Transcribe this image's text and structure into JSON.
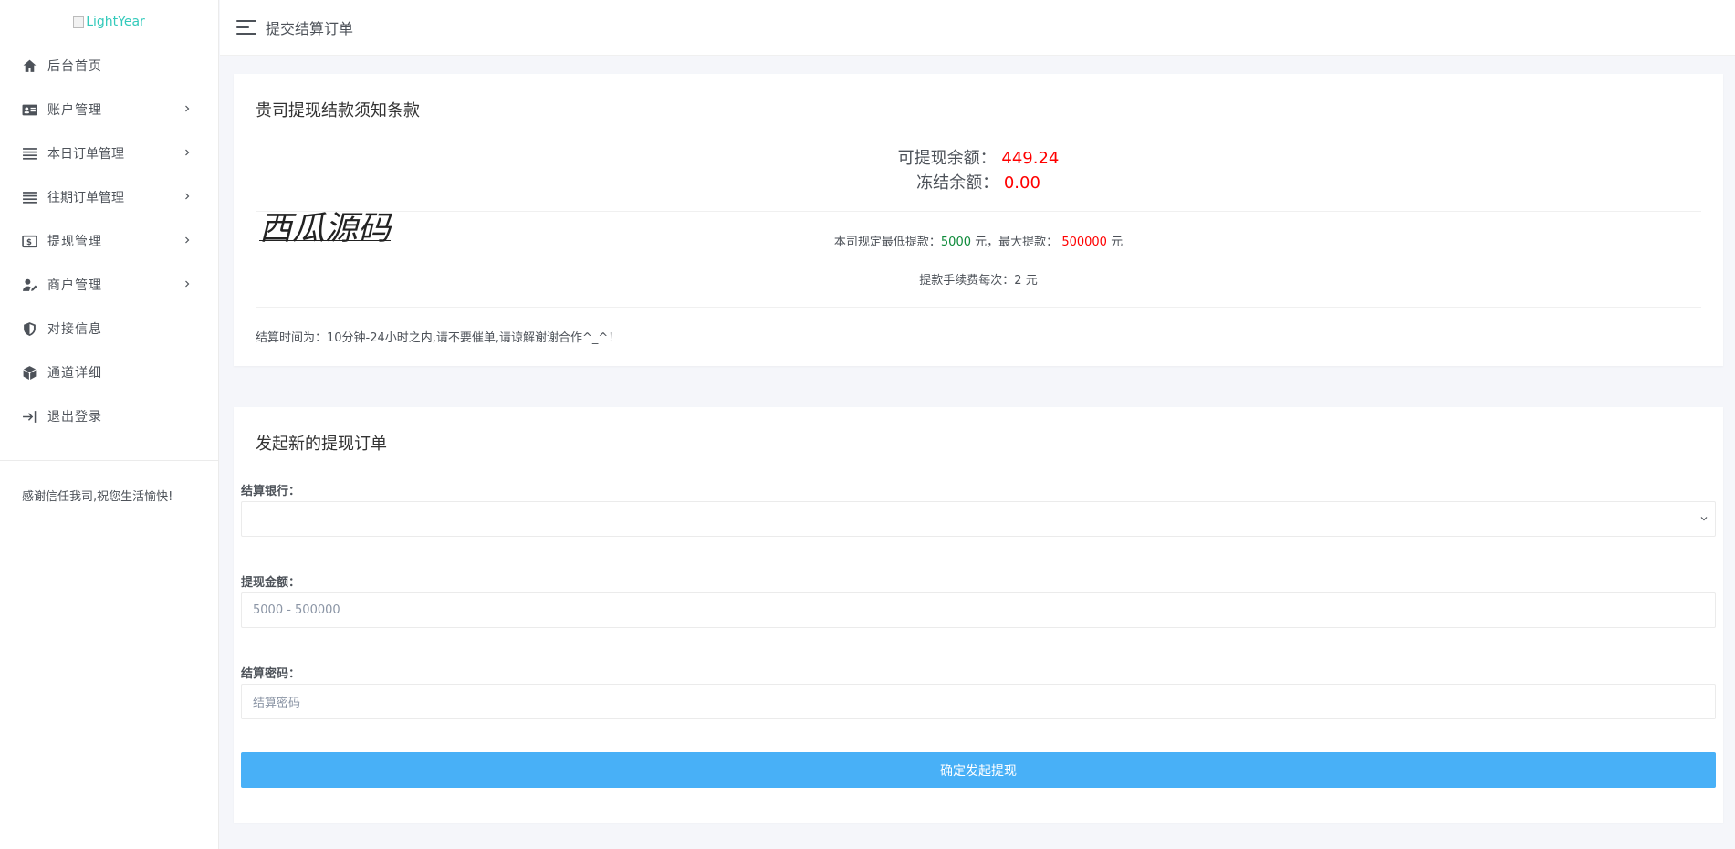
{
  "logo": {
    "alt_text": "LightYear"
  },
  "sidebar": {
    "items": [
      {
        "label": "后台首页",
        "icon": "home-icon",
        "has_children": false
      },
      {
        "label": "账户管理",
        "icon": "id-card-icon",
        "has_children": true
      },
      {
        "label": "本日订单管理",
        "icon": "list-icon",
        "has_children": true
      },
      {
        "label": "往期订单管理",
        "icon": "list-icon",
        "has_children": true
      },
      {
        "label": "提现管理",
        "icon": "money-icon",
        "has_children": true
      },
      {
        "label": "商户管理",
        "icon": "user-edit-icon",
        "has_children": true
      },
      {
        "label": "对接信息",
        "icon": "shield-icon",
        "has_children": false
      },
      {
        "label": "通道详细",
        "icon": "cube-icon",
        "has_children": false
      },
      {
        "label": "退出登录",
        "icon": "logout-icon",
        "has_children": false
      }
    ],
    "footer_text": "感谢信任我司,祝您生活愉快!"
  },
  "header": {
    "title": "提交结算订单"
  },
  "terms_card": {
    "title": "贵司提现结款须知条款",
    "available_label": "可提现余额：",
    "available_value": "449.24",
    "frozen_label": "冻结余额：",
    "frozen_value": "0.00",
    "watermark": "西瓜源码",
    "min_label": "本司规定最低提款：",
    "min_value": "5000",
    "unit": "元",
    "max_label": "，最大提款：",
    "max_value": "500000",
    "fee_text": "提款手续费每次：2 元",
    "note": "结算时间为：10分钟-24小时之内,请不要催单,请谅解谢谢合作^_^！"
  },
  "withdraw_form": {
    "title": "发起新的提现订单",
    "bank_label": "结算银行：",
    "bank_value": "",
    "amount_label": "提现金额：",
    "amount_placeholder": "5000 - 500000",
    "password_label": "结算密码：",
    "password_placeholder": "结算密码",
    "submit_label": "确定发起提现"
  },
  "colors": {
    "accent": "#48b0f7",
    "logo": "#33cabb",
    "danger": "#ff0000",
    "success": "#0e8a3a"
  }
}
